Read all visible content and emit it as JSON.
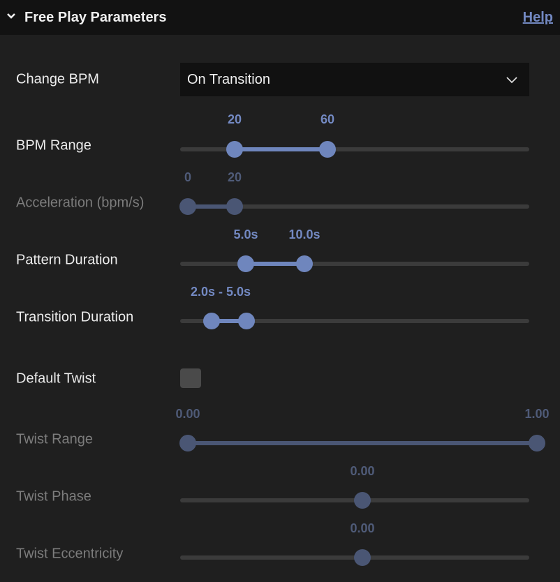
{
  "header": {
    "title": "Free Play Parameters",
    "help_label": "Help"
  },
  "change_bpm": {
    "label": "Change BPM",
    "value": "On Transition"
  },
  "bpm_range": {
    "label": "BPM Range",
    "values": [
      "20",
      "60"
    ],
    "fractions": [
      0.134,
      0.4
    ],
    "enabled": true
  },
  "acceleration": {
    "label": "Acceleration (bpm/s)",
    "values": [
      "0",
      "20"
    ],
    "fractions": [
      0,
      0.134
    ],
    "enabled": false
  },
  "pattern_duration": {
    "label": "Pattern Duration",
    "values": [
      "5.0s",
      "10.0s"
    ],
    "fractions": [
      0.166,
      0.334
    ],
    "enabled": true
  },
  "transition_duration": {
    "label": "Transition Duration",
    "value": "2.0s - 5.0s",
    "fractions": [
      0.068,
      0.168
    ],
    "enabled": true
  },
  "default_twist": {
    "label": "Default Twist",
    "checked": false
  },
  "twist_range": {
    "label": "Twist Range",
    "values": [
      "0.00",
      "1.00"
    ],
    "fractions": [
      0,
      1
    ],
    "enabled": false
  },
  "twist_phase": {
    "label": "Twist Phase",
    "value": "0.00",
    "fraction": 0.5,
    "enabled": false
  },
  "twist_eccentricity": {
    "label": "Twist Eccentricity",
    "value": "0.00",
    "fraction": 0.5,
    "enabled": false
  },
  "colors": {
    "accent": "#6f86bd",
    "disabled": "#4a5674",
    "track": "#3b3b3b"
  }
}
